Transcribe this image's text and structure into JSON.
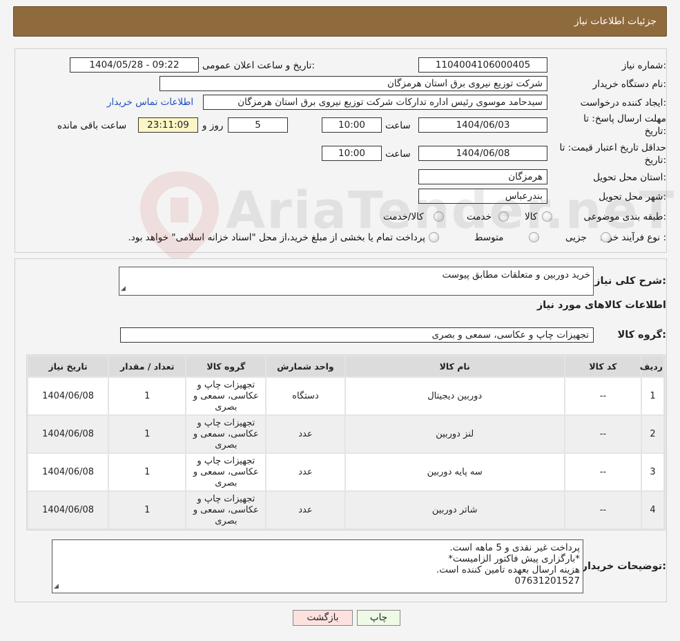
{
  "header": {
    "title": "جزئیات اطلاعات نیاز"
  },
  "form": {
    "need_number_label": "شماره نیاز:",
    "need_number": "1104004106000405",
    "announce_label": "تاریخ و ساعت اعلان عمومی:",
    "announce_value": "1404/05/28 - 09:22",
    "buyer_org_label": "نام دستگاه خریدار:",
    "buyer_org": "شرکت توزیع نیروی برق استان هرمزگان",
    "creator_label": "ایجاد کننده درخواست:",
    "creator": "سیدحامد موسوی رئیس اداره تدارکات شرکت توزیع نیروی برق استان هرمزگان",
    "contact_link": "اطلاعات تماس خریدار",
    "deadline_label_1": "مهلت ارسال پاسخ: تا",
    "deadline_label_2": "تاریخ:",
    "deadline_date": "1404/06/03",
    "time_label": "ساعت",
    "deadline_time": "10:00",
    "days_value": "5",
    "days_label": "روز و",
    "remaining_time": "23:11:09",
    "remaining_label": "ساعت باقی مانده",
    "validity_label_1": "حداقل تاریخ اعتبار قیمت: تا",
    "validity_label_2": "تاریخ:",
    "validity_date": "1404/06/08",
    "validity_time": "10:00",
    "province_label": "استان محل تحویل:",
    "province": "هرمزگان",
    "city_label": "شهر محل تحویل:",
    "city": "بندرعباس",
    "category_label": "طبقه بندی موضوعی:",
    "category_options": [
      "کالا",
      "خدمت",
      "کالا/خدمت"
    ],
    "process_label": "نوع فرآیند خرید :",
    "process_options": [
      "جزیی",
      "متوسط"
    ],
    "payment_note": "پرداخت تمام یا بخشی از مبلغ خرید،از محل \"اسناد خزانه اسلامی\" خواهد بود."
  },
  "watermark": {
    "text": "AriaTender.neT"
  },
  "details": {
    "summary_label": "شرح کلی نیاز:",
    "summary": "خرید دوربین و متعلقات مطابق پیوست",
    "goods_info_title": "اطلاعات کالاهای مورد نیاز",
    "goods_group_label": "گروه کالا:",
    "goods_group": "تجهیزات چاپ و عکاسی، سمعی و بصری",
    "table": {
      "headers": [
        "ردیف",
        "کد کالا",
        "نام کالا",
        "واحد شمارش",
        "گروه کالا",
        "تعداد / مقدار",
        "تاریخ نیاز"
      ],
      "rows": [
        [
          "1",
          "--",
          "دوربین دیجیتال",
          "دستگاه",
          "تجهیزات چاپ و عکاسی، سمعی و بصری",
          "1",
          "1404/06/08"
        ],
        [
          "2",
          "--",
          "لنز دوربین",
          "عدد",
          "تجهیزات چاپ و عکاسی، سمعی و بصری",
          "1",
          "1404/06/08"
        ],
        [
          "3",
          "--",
          "سه پایه دوربین",
          "عدد",
          "تجهیزات چاپ و عکاسی، سمعی و بصری",
          "1",
          "1404/06/08"
        ],
        [
          "4",
          "--",
          "شاتر دوربین",
          "عدد",
          "تجهیزات چاپ و عکاسی، سمعی و بصری",
          "1",
          "1404/06/08"
        ]
      ]
    },
    "buyer_notes_label": "توضیحات خریدار:",
    "buyer_notes": [
      "پرداخت غیر نقدی و 5 ماهه است.",
      "*بارگزاری پیش فاکتور الزامیست*",
      "هزینه ارسال بعهده تامین کننده است.",
      "07631201527"
    ]
  },
  "buttons": {
    "print": "چاپ",
    "back": "بازگشت"
  },
  "colors": {
    "header_bg": "#8f6a3c",
    "back_button_bg": "#fde1df",
    "print_button_bg": "#eef9e6",
    "link": "#1c4fc2"
  }
}
